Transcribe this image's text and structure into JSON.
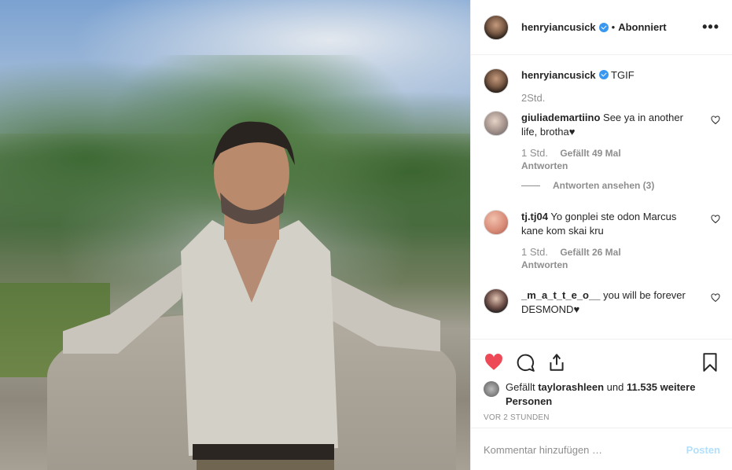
{
  "post": {
    "image_alt": "photo",
    "username": "henryiancusick",
    "separator": "•",
    "follow_status": "Abonniert",
    "more_label": "•••"
  },
  "caption": {
    "username": "henryiancusick",
    "text": "TGIF",
    "time": "2Std."
  },
  "comments": [
    {
      "username": "giuliademartiino",
      "text": "See ya in another life, brotha♥",
      "time": "1 Std.",
      "likes": "Gefällt 49 Mal",
      "reply": "Antworten",
      "view_replies": "Antworten ansehen (3)"
    },
    {
      "username": "tj.tj04",
      "text": "Yo gonplei ste odon Marcus kane kom skai kru",
      "time": "1 Std.",
      "likes": "Gefällt 26 Mal",
      "reply": "Antworten"
    },
    {
      "username": "_m_a_t_t_e_o__",
      "text": "you will be forever DESMOND♥"
    }
  ],
  "likes": {
    "prefix": "Gefällt",
    "user": "taylorashleen",
    "and": "und",
    "others": "11.535 weitere Personen"
  },
  "timeago": "VOR 2 STUNDEN",
  "add_comment": {
    "placeholder": "Kommentar hinzufügen …",
    "post_label": "Posten"
  },
  "colors": {
    "like_active": "#ed4956",
    "link_blue": "#3897f0",
    "post_disabled": "#b2dffc"
  }
}
